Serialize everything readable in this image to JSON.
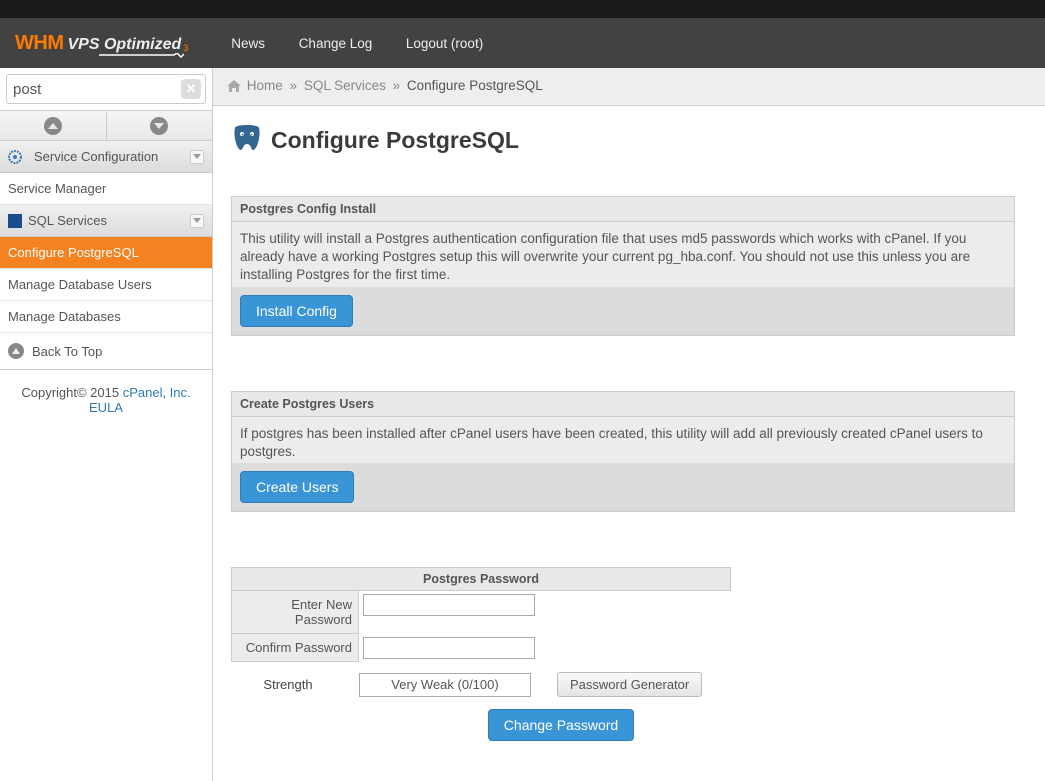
{
  "nav": {
    "news": "News",
    "change_log": "Change Log",
    "logout": "Logout (root)"
  },
  "logo": {
    "whm": "WHM",
    "vps": "VPS Optimized",
    "sub": "3"
  },
  "search": {
    "value": "post"
  },
  "breadcrumb": {
    "home": "Home",
    "sql": "SQL Services",
    "current": "Configure PostgreSQL"
  },
  "sidebar": {
    "section1": "Service Configuration",
    "item1": "Service Manager",
    "section2": "SQL Services",
    "item2a": "Configure PostgreSQL",
    "item2b": "Manage Database Users",
    "item2c": "Manage Databases",
    "back": "Back To Top"
  },
  "footer": {
    "copy": "Copyright© 2015 ",
    "cpanel": "cPanel, Inc.",
    "eula": "EULA"
  },
  "page": {
    "title": "Configure PostgreSQL"
  },
  "panel1": {
    "header": "Postgres Config Install",
    "body": "This utility will install a Postgres authentication configuration file that uses md5 passwords which works with cPanel. If you already have a working Postgres setup this will overwrite your current pg_hba.conf. You should not use this unless you are installing Postgres for the first time.",
    "button": "Install Config"
  },
  "panel2": {
    "header": "Create Postgres Users",
    "body": "If postgres has been installed after cPanel users have been created, this utility will add all previously created cPanel users to postgres.",
    "button": "Create Users"
  },
  "pw": {
    "header": "Postgres Password",
    "new": "Enter New Password",
    "confirm": "Confirm Password",
    "strength_label": "Strength",
    "strength_value": "Very Weak (0/100)",
    "generator": "Password Generator",
    "change": "Change Password"
  }
}
